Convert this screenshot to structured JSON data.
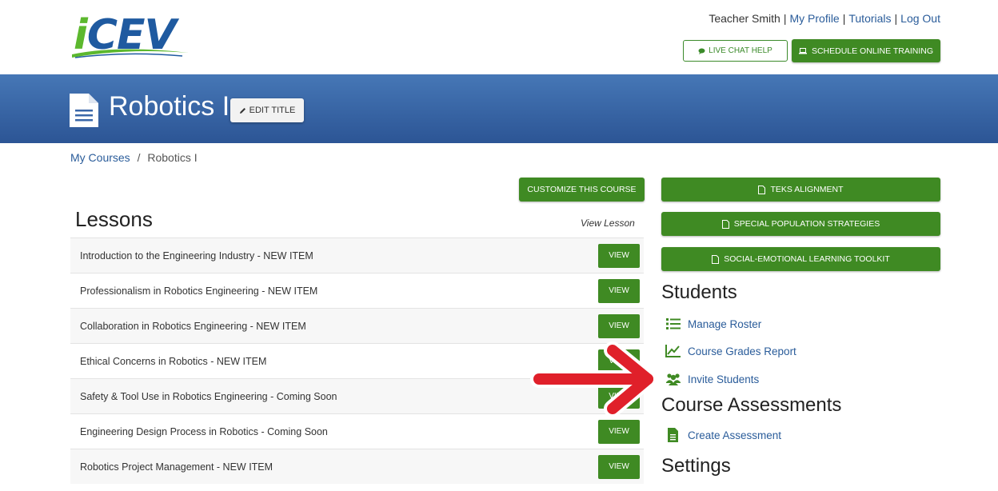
{
  "header": {
    "logo_text": "iCEV",
    "user_name": "Teacher Smith",
    "links": [
      "My Profile",
      "Tutorials",
      "Log Out"
    ],
    "separator": "|",
    "live_chat_label": "LIVE CHAT HELP",
    "schedule_label": "SCHEDULE ONLINE TRAINING"
  },
  "banner": {
    "course_title": "Robotics I",
    "edit_title_label": "EDIT TITLE"
  },
  "breadcrumb": {
    "root": "My Courses",
    "separator": "/",
    "current": "Robotics I"
  },
  "lessons": {
    "customize_label": "CUSTOMIZE THIS COURSE",
    "heading": "Lessons",
    "view_lesson_label": "View Lesson",
    "view_button_label": "VIEW",
    "items": [
      "Introduction to the Engineering Industry - NEW ITEM",
      "Professionalism in Robotics Engineering - NEW ITEM",
      "Collaboration in Robotics Engineering - NEW ITEM",
      "Ethical Concerns in Robotics - NEW ITEM",
      "Safety & Tool Use in Robotics Engineering - Coming Soon",
      "Engineering Design Process in Robotics - Coming Soon",
      "Robotics Project Management - NEW ITEM"
    ]
  },
  "resources": {
    "teks_label": "TEKS ALIGNMENT",
    "special_pop_label": "SPECIAL POPULATION STRATEGIES",
    "sel_label": "SOCIAL-EMOTIONAL LEARNING TOOLKIT"
  },
  "students": {
    "heading": "Students",
    "manage_roster": "Manage Roster",
    "grades_report": "Course Grades Report",
    "invite_students": "Invite Students"
  },
  "assessments": {
    "heading": "Course Assessments",
    "create": "Create Assessment"
  },
  "settings": {
    "heading": "Settings"
  },
  "colors": {
    "brand_blue": "#2c5595",
    "button_green": "#3f8a23",
    "link_blue": "#2a5c9a",
    "arrow_red": "#e0202a"
  }
}
